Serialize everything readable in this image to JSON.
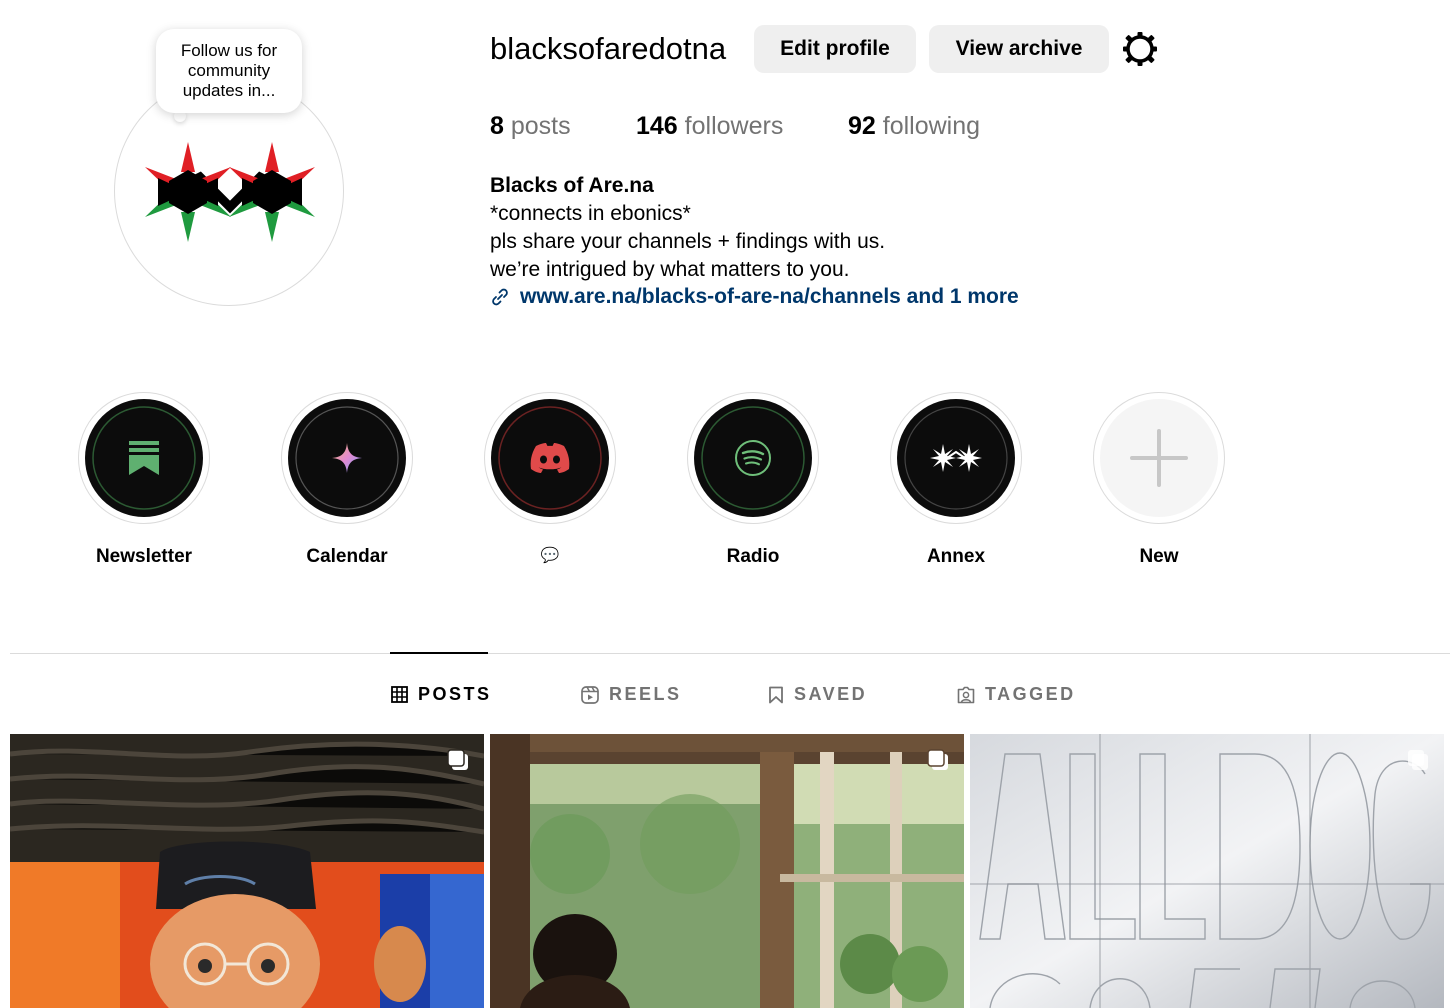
{
  "profile": {
    "username": "blacksofaredotna",
    "note": "Follow us for community updates in...",
    "avatar_icon": "double-star-logo-icon"
  },
  "actions": {
    "edit_profile": "Edit profile",
    "view_archive": "View archive",
    "settings_icon": "gear-icon"
  },
  "stats": {
    "posts_count": "8",
    "posts_label": "posts",
    "followers_count": "146",
    "followers_label": "followers",
    "following_count": "92",
    "following_label": "following"
  },
  "bio": {
    "name": "Blacks of Are.na",
    "line1": "*connects in ebonics*",
    "line2": "pls share your channels + findings with us.",
    "line3": "we’re intrigued by what matters to you.",
    "link": "www.are.na/blacks-of-are-na/channels and 1 more"
  },
  "highlights": [
    {
      "label": "Newsletter",
      "icon": "bookmark-flag-icon",
      "accent": "#5fb070"
    },
    {
      "label": "Calendar",
      "icon": "sparkle-icon",
      "accent": "#c9a3e6"
    },
    {
      "label": "💬",
      "icon": "discord-icon",
      "accent": "#e04a4a"
    },
    {
      "label": "Radio",
      "icon": "spotify-icon",
      "accent": "#6fbf7a"
    },
    {
      "label": "Annex",
      "icon": "double-star-icon",
      "accent": "#ffffff"
    },
    {
      "label": "New",
      "icon": "plus-icon",
      "accent": "#c7c7c7"
    }
  ],
  "tabs": [
    {
      "label": "POSTS",
      "icon": "grid-icon",
      "active": true
    },
    {
      "label": "REELS",
      "icon": "reels-icon",
      "active": false
    },
    {
      "label": "SAVED",
      "icon": "bookmark-icon",
      "active": false
    },
    {
      "label": "TAGGED",
      "icon": "tagged-user-icon",
      "active": false
    }
  ],
  "colors": {
    "link": "#00376b",
    "muted": "#737373",
    "button_bg": "#efefef"
  }
}
